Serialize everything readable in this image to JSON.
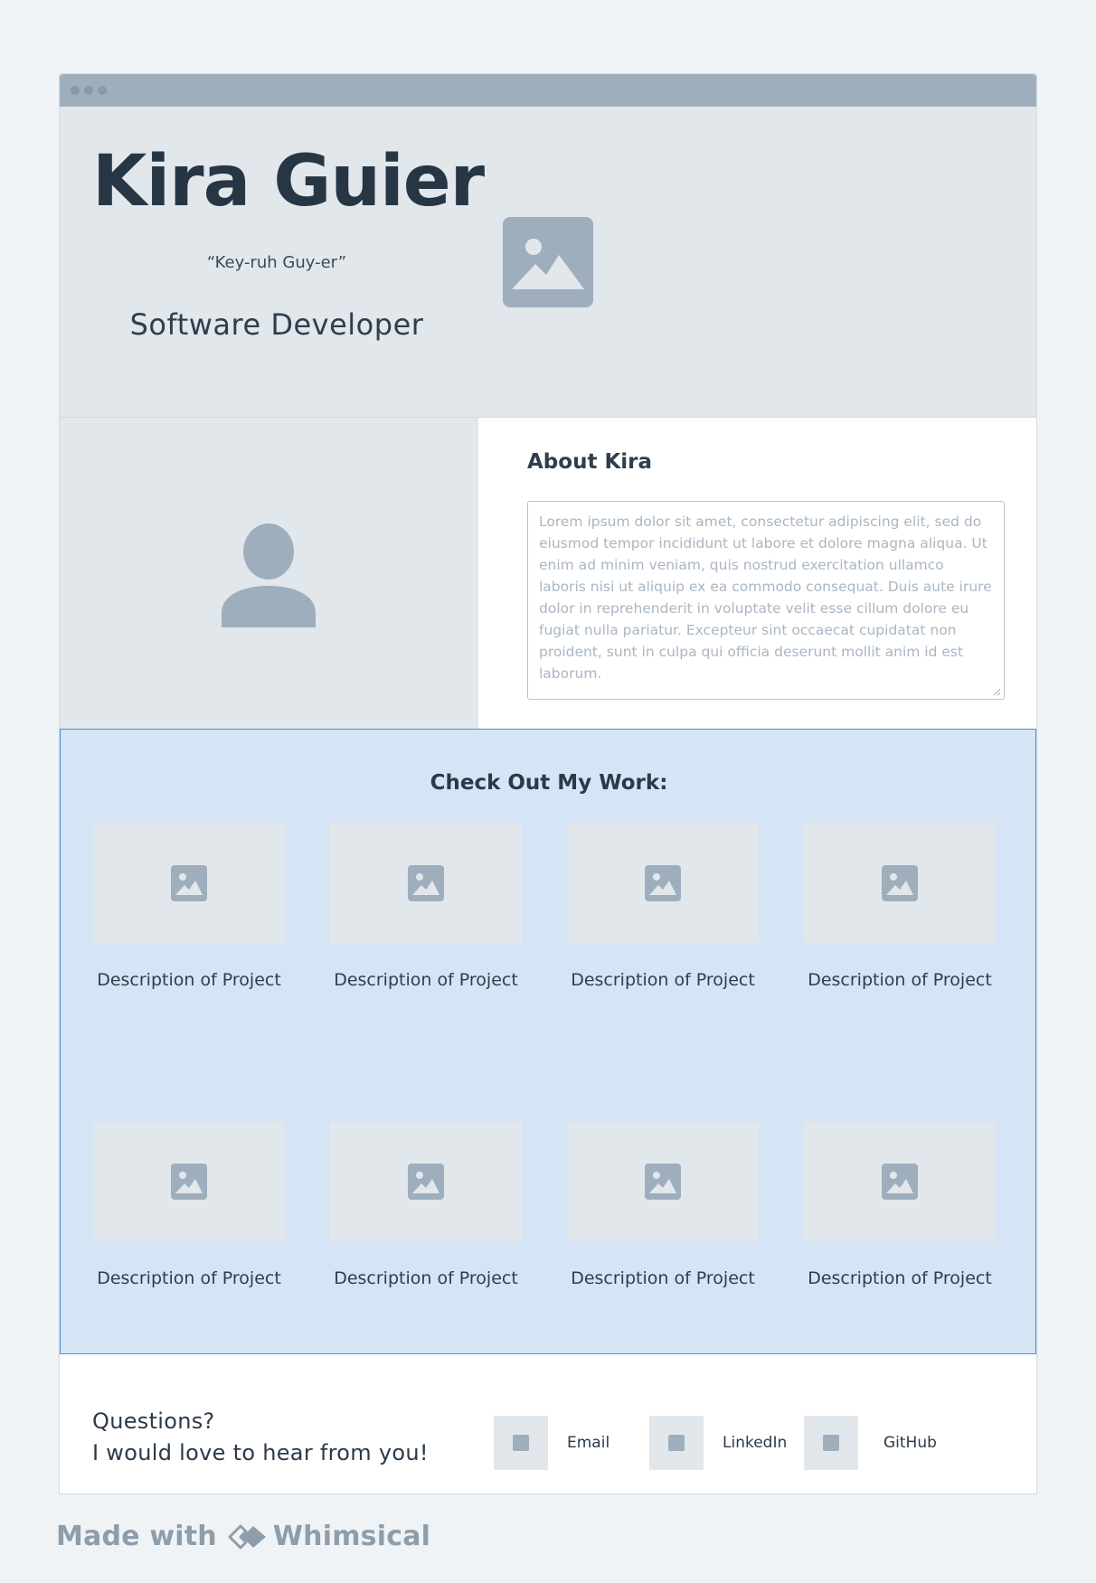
{
  "hero": {
    "name": "Kira Guier",
    "pronunciation": "“Key-ruh Guy-er”",
    "role": "Software Developer",
    "image_icon": "image-placeholder-icon"
  },
  "profile": {
    "avatar_icon": "user-avatar-icon"
  },
  "about": {
    "title": "About Kira",
    "body": "Lorem ipsum dolor sit amet, consectetur adipiscing elit, sed do eiusmod tempor incididunt ut labore et dolore magna aliqua. Ut enim ad minim veniam, quis nostrud exercitation ullamco laboris nisi ut aliquip ex ea commodo consequat. Duis aute irure dolor in reprehenderit in voluptate velit esse cillum dolore eu fugiat nulla pariatur. Excepteur sint occaecat cupidatat non proident, sunt in culpa qui officia deserunt mollit anim id est laborum."
  },
  "work": {
    "title": "Check Out My Work:",
    "projects": [
      {
        "label": "Description of Project"
      },
      {
        "label": "Description of Project"
      },
      {
        "label": "Description of Project"
      },
      {
        "label": "Description of Project"
      },
      {
        "label": "Description of Project"
      },
      {
        "label": "Description of Project"
      },
      {
        "label": "Description of Project"
      },
      {
        "label": "Description of Project"
      }
    ]
  },
  "contact": {
    "line1": "Questions?",
    "line2": "I would love to hear from you!",
    "links": [
      {
        "label": "Email",
        "icon": "email-icon"
      },
      {
        "label": "LinkedIn",
        "icon": "linkedin-icon"
      },
      {
        "label": "GitHub",
        "icon": "github-icon"
      }
    ]
  },
  "footer": {
    "made_with": "Made with",
    "brand": "Whimsical"
  },
  "colors": {
    "accent": "#4a90d9",
    "placeholder": "#9eaebd",
    "panel": "#e2e7ec",
    "work_bg": "#d5e5f5"
  }
}
